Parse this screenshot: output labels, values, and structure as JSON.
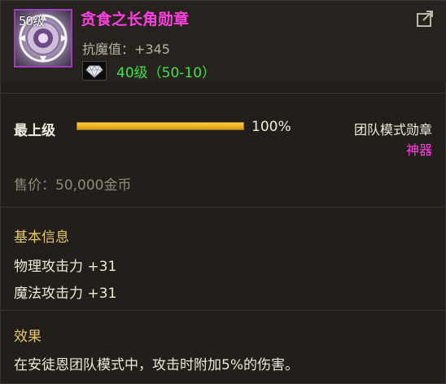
{
  "item": {
    "level_badge": "50级",
    "name": "贪食之长角勋章",
    "stat": "抗魔值：+345",
    "gem_level": "40级（50-10）"
  },
  "upgrade": {
    "label": "最上级",
    "progress_percent": 100,
    "progress_text": "100%"
  },
  "category": {
    "mode": "团队模式勋章",
    "rarity": "神器"
  },
  "price": "售价：50,000金币",
  "basic_info": {
    "title": "基本信息",
    "attrs": [
      "物理攻击力 +31",
      "魔法攻击力 +31"
    ]
  },
  "effect": {
    "title": "效果",
    "desc": "在安徒恩团队模式中，攻击时附加5%的伤害。"
  },
  "colors": {
    "name": "#ff3fe1",
    "gem_level": "#3be24a",
    "section_title": "#e8c66a",
    "progress": "#ffcf3a"
  },
  "icons": [
    "medal-icon",
    "share-icon",
    "gem-icon"
  ]
}
